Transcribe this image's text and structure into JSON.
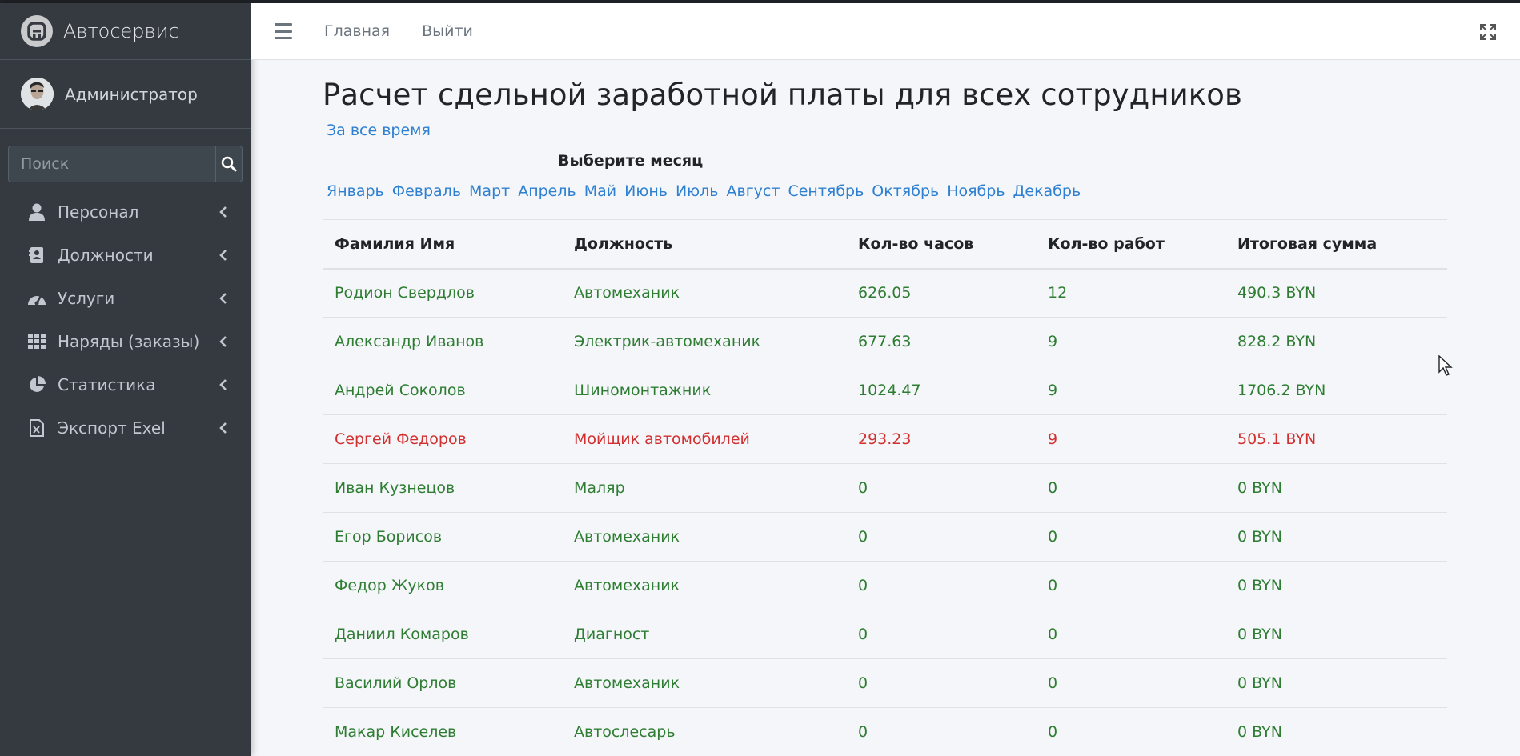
{
  "brand": {
    "name": "Автосервис"
  },
  "user": {
    "name": "Администратор"
  },
  "search": {
    "placeholder": "Поиск"
  },
  "sidebar": {
    "items": [
      {
        "label": "Персонал",
        "icon": "user-icon"
      },
      {
        "label": "Должности",
        "icon": "id-card-icon"
      },
      {
        "label": "Услуги",
        "icon": "gauge-icon"
      },
      {
        "label": "Наряды (заказы)",
        "icon": "grid-icon"
      },
      {
        "label": "Статистика",
        "icon": "pie-chart-icon"
      },
      {
        "label": "Экспорт Exel",
        "icon": "excel-file-icon"
      }
    ]
  },
  "navbar": {
    "home": "Главная",
    "logout": "Выйти"
  },
  "page": {
    "title": "Расчет сдельной заработной платы для всех сотрудников",
    "all_time": "За все время",
    "month_header": "Выберите месяц",
    "months": [
      "Январь",
      "Февраль",
      "Март",
      "Апрель",
      "Май",
      "Июнь",
      "Июль",
      "Август",
      "Сентябрь",
      "Октябрь",
      "Ноябрь",
      "Декабрь"
    ]
  },
  "table": {
    "headers": [
      "Фамилия Имя",
      "Должность",
      "Кол-во часов",
      "Кол-во работ",
      "Итоговая сумма"
    ],
    "rows": [
      [
        "Родион Свердлов",
        "Автомеханик",
        "626.05",
        "12",
        "490.3 BYN"
      ],
      [
        "Александр Иванов",
        "Электрик-автомеханик",
        "677.63",
        "9",
        "828.2 BYN"
      ],
      [
        "Андрей Соколов",
        "Шиномонтажник",
        "1024.47",
        "9",
        "1706.2 BYN"
      ],
      [
        "Сергей Федоров",
        "Мойщик автомобилей",
        "293.23",
        "9",
        "505.1 BYN"
      ],
      [
        "Иван Кузнецов",
        "Маляр",
        "0",
        "0",
        "0 BYN"
      ],
      [
        "Егор Борисов",
        "Автомеханик",
        "0",
        "0",
        "0 BYN"
      ],
      [
        "Федор Жуков",
        "Автомеханик",
        "0",
        "0",
        "0 BYN"
      ],
      [
        "Даниил Комаров",
        "Диагност",
        "0",
        "0",
        "0 BYN"
      ],
      [
        "Василий Орлов",
        "Автомеханик",
        "0",
        "0",
        "0 BYN"
      ],
      [
        "Макар Киселев",
        "Автослесарь",
        "0",
        "0",
        "0 BYN"
      ]
    ]
  },
  "colors": {
    "ok": "#2e7d32",
    "bad": "#d32f2f",
    "link": "#2f80d1",
    "sidebar": "#343a40"
  }
}
